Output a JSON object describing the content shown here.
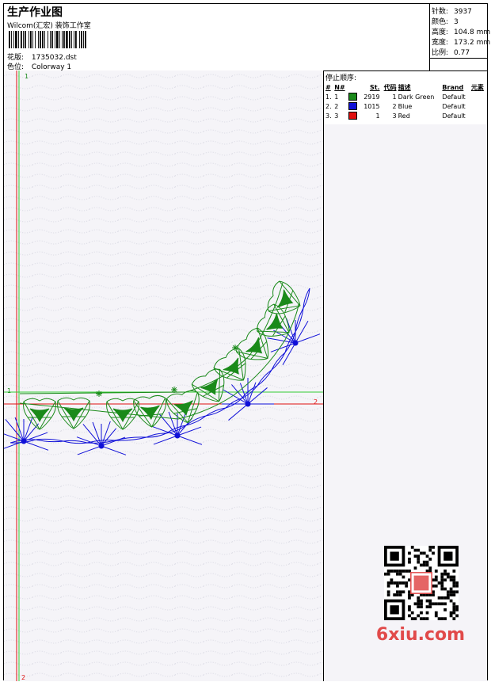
{
  "header": {
    "title": "生产作业图",
    "studio": "Wilcom(汇宏) 装饰工作室",
    "design_label": "花版:",
    "design_value": "1735032.dst",
    "colorway_label": "色位:",
    "colorway_value": "Colorway 1"
  },
  "stats": {
    "stitches_label": "针数:",
    "stitches_value": "3937",
    "colors_label": "颜色:",
    "colors_value": "3",
    "height_label": "高度:",
    "height_value": "104.8 mm",
    "width_label": "宽度:",
    "width_value": "173.2 mm",
    "scale_label": "比例:",
    "scale_value": "0.77"
  },
  "sequence": {
    "title": "停止顺序:",
    "columns": [
      "#",
      "N#",
      "St.",
      "代码",
      "描述",
      "Brand",
      "元素"
    ],
    "rows": [
      {
        "idx": "1.",
        "n": "1",
        "color": "#1a8a1a",
        "st": "2919",
        "code": "1",
        "desc": "Dark Green",
        "brand": "Default"
      },
      {
        "idx": "2.",
        "n": "2",
        "color": "#1010d8",
        "st": "1015",
        "code": "2",
        "desc": "Blue",
        "brand": "Default"
      },
      {
        "idx": "3.",
        "n": "3",
        "color": "#e01010",
        "st": "1",
        "code": "3",
        "desc": "Red",
        "brand": "Default"
      }
    ]
  },
  "guides": {
    "top_mark": "1",
    "left_mark": "1",
    "right_mark": "2",
    "bottom_mark": "2"
  },
  "watermark": {
    "site": "6xiu.com"
  },
  "colors": {
    "green": "#1a8a1a",
    "blue": "#1010d8",
    "red": "#e01010",
    "guide_green": "#33cc33"
  }
}
